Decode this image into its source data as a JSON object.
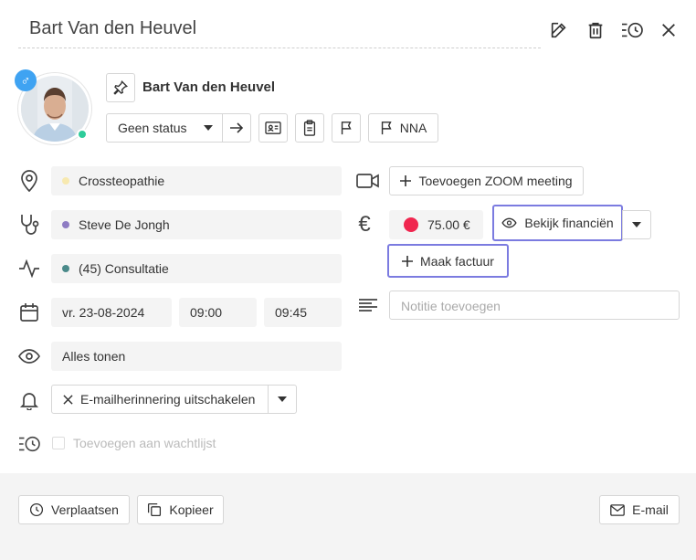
{
  "header": {
    "title": "Bart Van den Heuvel"
  },
  "patient": {
    "name": "Bart Van den Heuvel",
    "gender_symbol": "♂"
  },
  "status": {
    "selected": "Geen status",
    "flag_label": "NNA"
  },
  "fields": {
    "location": "Crossteopathie",
    "location_color": "#f7e9b0",
    "therapist": "Steve De Jongh",
    "therapist_color": "#8e7cc3",
    "service": "(45) Consultatie",
    "service_color": "#4a8a8a",
    "date": "vr. 23-08-2024",
    "start_time": "09:00",
    "end_time": "09:45",
    "visibility": "Alles tonen",
    "reminder": "E-mailherinnering uitschakelen",
    "waitlist": "Toevoegen aan wachtlijst"
  },
  "right": {
    "zoom_label": "Toevoegen ZOOM meeting",
    "price": "75.00 €",
    "price_color": "#f0264f",
    "view_finance_label": "Bekijk financiën",
    "invoice_label": "Maak factuur",
    "note_placeholder": "Notitie toevoegen"
  },
  "footer": {
    "move_label": "Verplaatsen",
    "copy_label": "Kopieer",
    "email_label": "E-mail"
  },
  "colors": {
    "accent_highlight": "#7b7be0",
    "online": "#2ecc9a",
    "gender_badge": "#3fa3f2"
  }
}
